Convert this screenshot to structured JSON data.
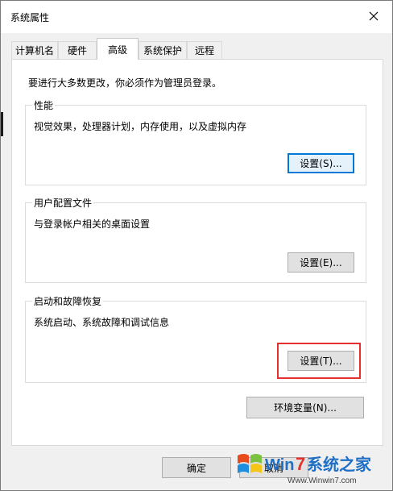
{
  "window": {
    "title": "系统属性"
  },
  "tabs": [
    {
      "label": "计算机名"
    },
    {
      "label": "硬件"
    },
    {
      "label": "高级"
    },
    {
      "label": "系统保护"
    },
    {
      "label": "远程"
    }
  ],
  "active_tab": "高级",
  "admin_note": "要进行大多数更改，你必须作为管理员登录。",
  "performance": {
    "label": "性能",
    "description": "视觉效果，处理器计划，内存使用，以及虚拟内存",
    "button": "设置(S)..."
  },
  "user_profiles": {
    "label": "用户配置文件",
    "description": "与登录帐户相关的桌面设置",
    "button": "设置(E)..."
  },
  "startup_recovery": {
    "label": "启动和故障恢复",
    "description": "系统启动、系统故障和调试信息",
    "button": "设置(T)..."
  },
  "env_button": "环境变量(N)...",
  "ok_button": "确定",
  "cancel_button": "取消",
  "watermark": {
    "logo_text": "Win7系统之家",
    "site": "Www.Winwin7.com"
  },
  "colors": {
    "highlight": "#e5312d",
    "focus": "#0078d7"
  }
}
